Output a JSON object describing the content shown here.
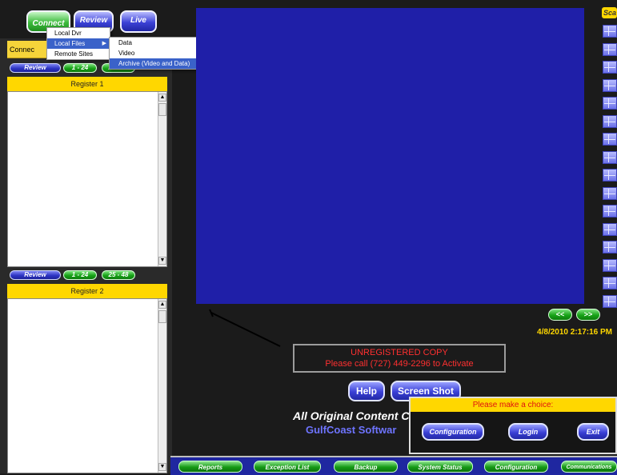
{
  "top_buttons": {
    "connect": "Connect",
    "review": "Review",
    "live": "Live"
  },
  "connect_menu": {
    "items": [
      "Local Dvr",
      "Local Files",
      "Remote Sites"
    ],
    "selected": "Local Files"
  },
  "local_files_submenu": {
    "items": [
      "Data",
      "Video",
      "Archive (Video and Data)"
    ],
    "selected": "Archive (Video and Data)"
  },
  "left_panel": {
    "tab_label": "Connec",
    "register1": {
      "review_label": "Review",
      "range1": "1 - 24",
      "range2": "25 - 48",
      "title": "Register 1"
    },
    "register2": {
      "review_label": "Review",
      "range1": "1 - 24",
      "range2": "25 - 48",
      "title": "Register 2"
    }
  },
  "scan_label": "Sca",
  "nav": {
    "prev": "<<",
    "next": ">>"
  },
  "datetime": "4/8/2010 2:17:16 PM",
  "unregistered": {
    "line1": "UNREGISTERED COPY",
    "line2": "Please call (727) 449-2296 to Activate"
  },
  "help_label": "Help",
  "screenshot_label": "Screen Shot",
  "footer": {
    "line1": "All Original Content C",
    "line2": "GulfCoast Softwar"
  },
  "dialog": {
    "title": "Please make a choice:",
    "configuration": "Configuration",
    "login": "Login",
    "exit": "Exit"
  },
  "bottom_bar": [
    "Reports",
    "Exception List",
    "Backup",
    "System Status",
    "Configuration",
    "Communications"
  ],
  "colors": {
    "video_bg": "#1f1fa8",
    "accent_yellow": "#ffd700",
    "alert_red": "#ff3030"
  }
}
